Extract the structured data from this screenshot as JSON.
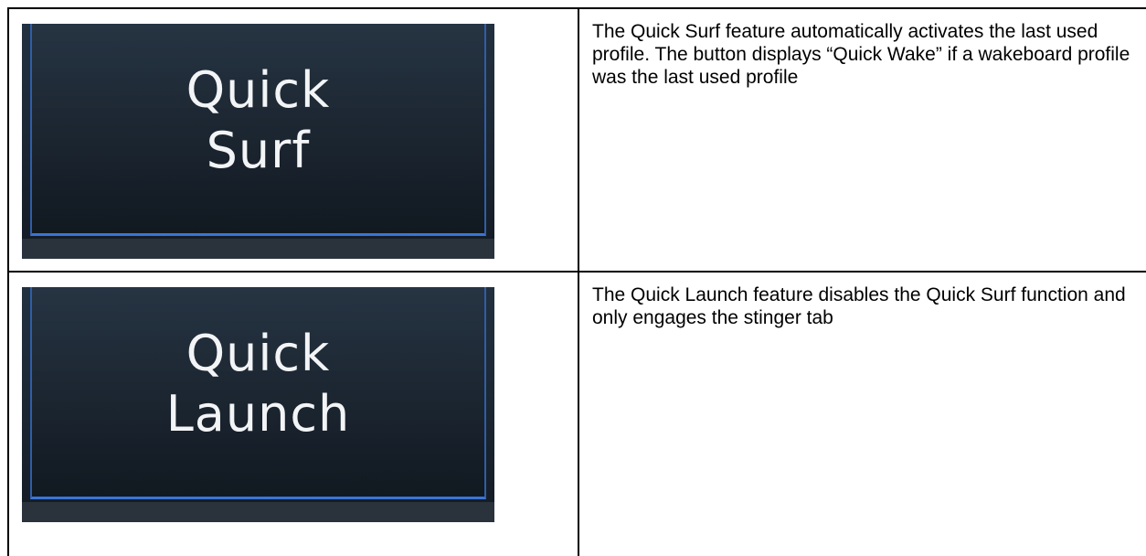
{
  "rows": [
    {
      "button": {
        "line1": "Quick",
        "line2": "Surf"
      },
      "description": "The Quick Surf feature automatically activates the last used profile. The button displays “Quick Wake” if a wakeboard profile was the last used profile"
    },
    {
      "button": {
        "line1": "Quick",
        "line2": "Launch"
      },
      "description": "The Quick Launch feature disables the Quick Surf function and only engages the stinger tab"
    }
  ],
  "colors": {
    "button_background": "#1b2632",
    "button_accent": "#3a74d6",
    "button_text": "#f2f4f6",
    "border": "#000000"
  }
}
